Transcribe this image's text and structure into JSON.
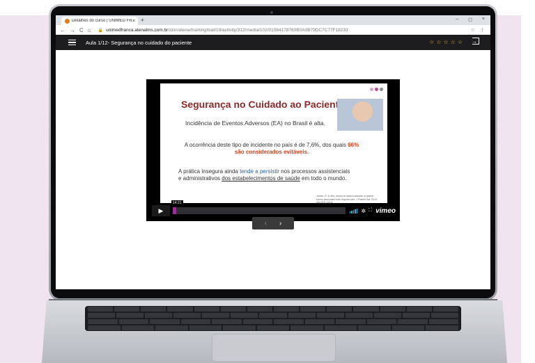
{
  "browser": {
    "tab_title": "Detalhes do curso | UNIMED FRA",
    "tab_close": "×",
    "new_tab": "+",
    "nav_back": "←",
    "nav_forward": "→",
    "nav_reload": "C",
    "nav_home": "⌂",
    "url_domain": "unimedfranca.atenalms.com.br",
    "url_path": "/skin/atena/training/trail/19/activity/312/media/102/01564178760B0A0B79DC7C77F18233",
    "win_min": "–",
    "win_max": "◻",
    "win_close": "×",
    "bookmark_star": "☆",
    "menu_dots": "⋮"
  },
  "app": {
    "lesson_title": "Aula 1/12- Segurança no cuidado do paciente",
    "rating_stars": [
      "☆",
      "☆",
      "☆",
      "☆",
      "☆"
    ],
    "rating_color": "#f4c430"
  },
  "slide": {
    "title": "Segurança no Cuidado ao Paciente",
    "subtitle": "Incidência de Eventos Adversos (EA) no Brasil é alta.",
    "p1_a": "A ocorrência deste tipo de incidente no país é de 7,6%, dos quais ",
    "p1_red": "66% são considerados evitáveis.",
    "p2_a": "A prática insegura ainda ",
    "p2_blue": "tende a persistir",
    "p2_b": " nos processos assistenciais e administrativos ",
    "p2_ul1": "dos estabelecimentos de saúde",
    "p2_c": " em todo o mundo.",
    "reference": "James JT. A new, evidence-based estimate of patient harms associated with hospital care. J Patient Saf. 2013 Sep;9(3):122-8.",
    "title_color": "#8b2a2a",
    "highlight_red": "#d0421b",
    "highlight_blue": "#2a60a8"
  },
  "player": {
    "time": "14:21",
    "progress": 0.02,
    "play_icon": "▶",
    "settings_icon": "✲",
    "fullscreen_icon": "⛶",
    "brand": "vimeo",
    "accent": "#9b2f9a",
    "volume_color": "#17b8e0"
  },
  "pager": {
    "prev": "‹",
    "next": "›"
  }
}
